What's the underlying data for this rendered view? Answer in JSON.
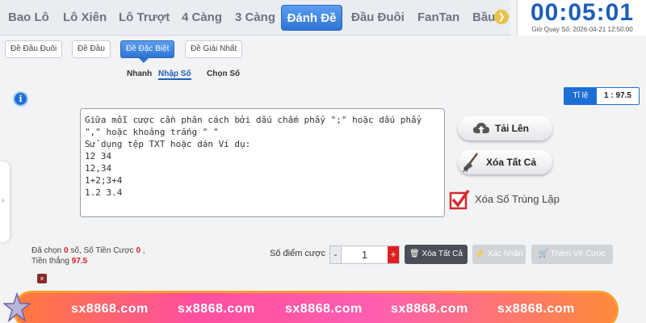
{
  "tabs": [
    {
      "label": "Bao Lô",
      "active": false
    },
    {
      "label": "Lô Xiên",
      "active": false
    },
    {
      "label": "Lô Trượt",
      "active": false
    },
    {
      "label": "4 Càng",
      "active": false
    },
    {
      "label": "3 Càng",
      "active": false
    },
    {
      "label": "Đánh Đề",
      "active": true
    },
    {
      "label": "Đầu Đuôi",
      "active": false
    },
    {
      "label": "FanTan",
      "active": false
    },
    {
      "label": "Bầu",
      "active": false
    }
  ],
  "tab_next_icon": "chevron-right-icon",
  "clock": {
    "time": "00:05:01",
    "label": "Giờ Quay Số: 2026-04-21 12:50:00"
  },
  "subtabs": [
    {
      "label": "Đề Đầu Đuôi",
      "active": false
    },
    {
      "label": "Đề Đầu",
      "active": false
    },
    {
      "label": "Đề Đặc Biệt",
      "active": true
    },
    {
      "label": "Đề Giải Nhất",
      "active": false
    }
  ],
  "modes": [
    {
      "label": "Nhanh",
      "active": false
    },
    {
      "label": "Nhập Số",
      "active": true
    },
    {
      "label": "Chọn Số",
      "active": false
    }
  ],
  "ratio": {
    "label": "Tỉ lệ",
    "value": "1 : 97.5"
  },
  "textarea": {
    "placeholder": "Giữa mỗi cược cần phân cách bởi dấu chấm phẩy \";\" hoặc dấu phẩy\n\",\" hoặc khoảng trắng \" \"\nSử dụng tệp TXT hoặc dán Ví dụ:\n12 34\n12,34\n1+2;3+4\n1.2 3.4"
  },
  "actions": {
    "upload": "Tải Lên",
    "clear_all": "Xóa Tất Cả"
  },
  "dedupe": {
    "label": "Xóa Số Trùng Lặp",
    "checked": true
  },
  "summary": {
    "chosen_label": "Đã chọn",
    "chosen_value": "0",
    "chosen_unit": "số,",
    "amount_label": "Số Tiền Cược",
    "amount_value": "0",
    "amount_suffix": ",",
    "win_label": "Tiền thắng",
    "win_value": "97.5"
  },
  "points": {
    "label": "Số điểm cược",
    "minus": "-",
    "value": "1",
    "plus": "+"
  },
  "buttons": {
    "clear": "Xóa Tất Cả",
    "confirm": "Xác Nhận",
    "cart": "Thêm Vé Cược"
  },
  "close_symbol": "×",
  "banner": {
    "texts": [
      "sx8868.com",
      "sx8868.com",
      "sx8868.com",
      "sx8868.com",
      "sx8868.com"
    ]
  },
  "colors": {
    "accent": "#2f74d4",
    "danger": "#e02020",
    "clock": "#1d5fb8"
  }
}
